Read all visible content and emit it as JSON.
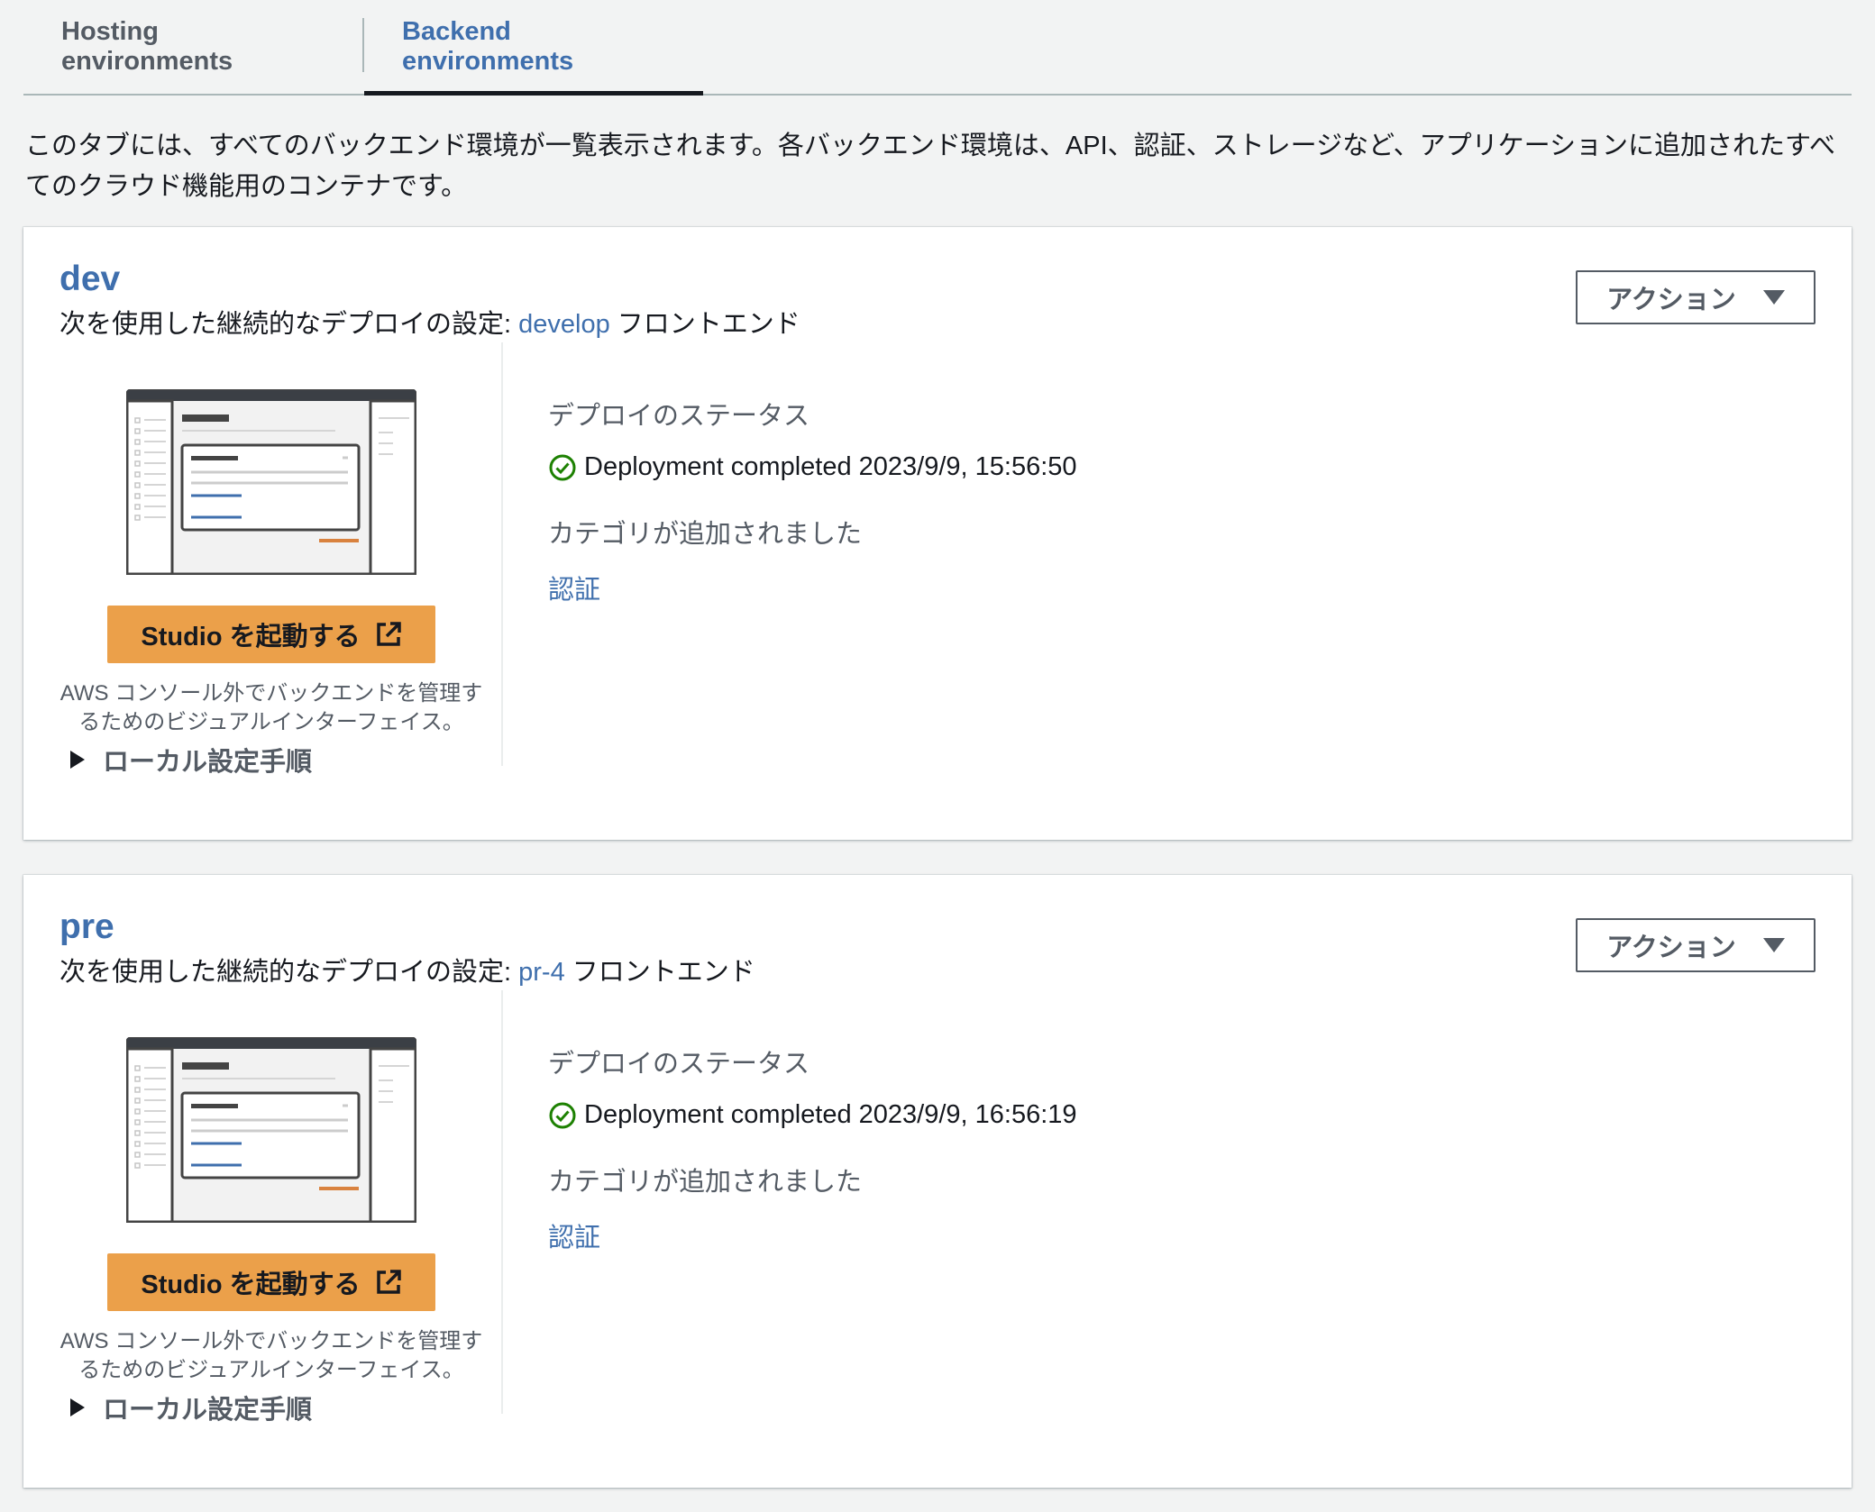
{
  "tabs": [
    {
      "label": "Hosting environments",
      "active": false
    },
    {
      "label": "Backend environments",
      "active": true
    }
  ],
  "intro": "このタブには、すべてのバックエンド環境が一覧表示されます。各バックエンド環境は、API、認証、ストレージなど、アプリケーションに追加されたすべてのクラウド機能用のコンテナです。",
  "colors": {
    "accent": "#3f6fad",
    "studio_button": "#eba04a",
    "success": "#1d8102"
  },
  "environments": [
    {
      "name": "dev",
      "sub_prefix": "次を使用した継続的なデプロイの設定: ",
      "branch": "develop",
      "sub_suffix": " フロントエンド",
      "action_label": "アクション",
      "studio_label": "Studio を起動する",
      "studio_desc": "AWS コンソール外でバックエンドを管理するためのビジュアルインターフェイス。",
      "local_setup": "ローカル設定手順",
      "status_label": "デプロイのステータス",
      "status": "Deployment completed 2023/9/9, 15:56:50",
      "category_label": "カテゴリが追加されました",
      "category": "認証"
    },
    {
      "name": "pre",
      "sub_prefix": "次を使用した継続的なデプロイの設定: ",
      "branch": "pr-4",
      "sub_suffix": " フロントエンド",
      "action_label": "アクション",
      "studio_label": "Studio を起動する",
      "studio_desc": "AWS コンソール外でバックエンドを管理するためのビジュアルインターフェイス。",
      "local_setup": "ローカル設定手順",
      "status_label": "デプロイのステータス",
      "status": "Deployment completed 2023/9/9, 16:56:19",
      "category_label": "カテゴリが追加されました",
      "category": "認証"
    }
  ]
}
